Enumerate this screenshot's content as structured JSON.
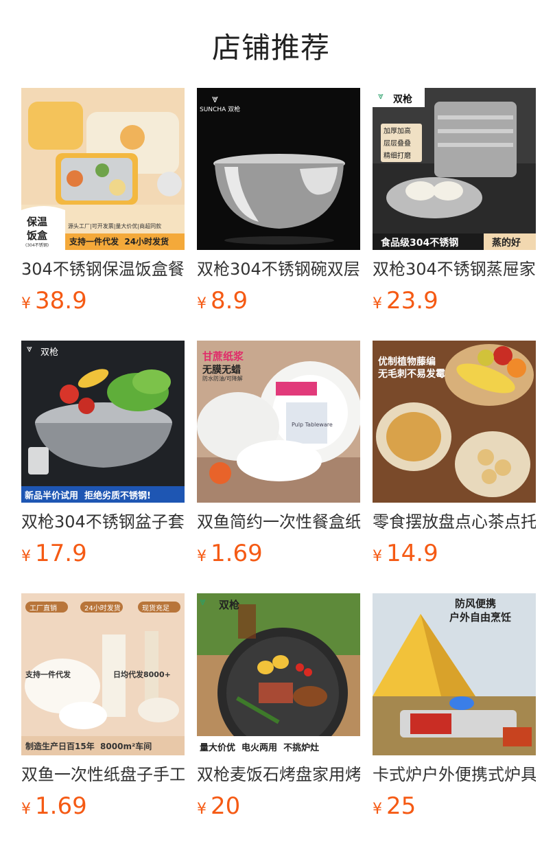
{
  "header": {
    "title": "店铺推荐"
  },
  "currency_symbol": "¥",
  "products": [
    {
      "name": "304不锈钢保温饭盒餐",
      "price": "38.9",
      "overlays": [
        "保温",
        "饭盒",
        "(304不锈钢)",
        "源头工厂|可开发票|量大价优|商超同款",
        "支持一件代发  24小时发货"
      ]
    },
    {
      "name": "双枪304不锈钢碗双层",
      "price": "8.9",
      "overlays": [
        "SUNCHA 双枪"
      ]
    },
    {
      "name": "双枪304不锈钢蒸屉家",
      "price": "23.9",
      "overlays": [
        "双枪",
        "加厚加高",
        "层层叠叠",
        "精细打磨",
        "食品级304不锈钢",
        "蒸的好"
      ]
    },
    {
      "name": "双枪304不锈钢盆子套",
      "price": "17.9",
      "overlays": [
        "双枪",
        "新品半价试用  拒绝劣质不锈钢!"
      ]
    },
    {
      "name": "双鱼简约一次性餐盒纸",
      "price": "1.69",
      "overlays": [
        "甘蔗纸浆",
        "无膜无蜡",
        "防水防油/可降解",
        "Pulp Tableware"
      ]
    },
    {
      "name": "零食摆放盘点心茶点托",
      "price": "14.9",
      "overlays": [
        "优制植物藤编",
        "无毛刺不易发霉"
      ]
    },
    {
      "name": "双鱼一次性纸盘子手工",
      "price": "1.69",
      "overlays": [
        "工厂直销",
        "24小时发货",
        "现货充足",
        "支持一件代发",
        "日均代发8000+",
        "制造生产日百15年  8000m²车间"
      ]
    },
    {
      "name": "双枪麦饭石烤盘家用烤",
      "price": "20",
      "overlays": [
        "双枪",
        "量大价优  电火两用  不挑炉灶"
      ]
    },
    {
      "name": "卡式炉户外便携式炉具",
      "price": "25",
      "overlays": [
        "防风便携",
        "户外自由烹饪"
      ]
    }
  ]
}
